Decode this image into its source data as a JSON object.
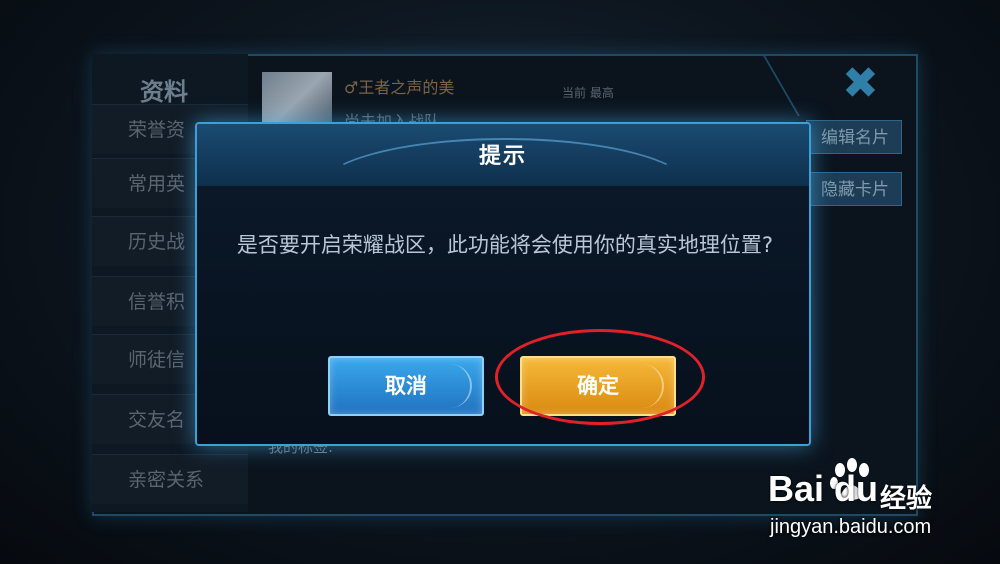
{
  "background": {
    "panel_title": "资料",
    "sidebar_items": [
      "荣誉资",
      "常用英",
      "历史战",
      "信誉积",
      "师徒信",
      "交友名",
      "亲密关系"
    ],
    "player_name": "♂王者之声的美",
    "join_text": "尚未加入战队",
    "rank_labels": "当前  最高",
    "buttons": [
      "编辑名片",
      "隐藏卡片"
    ],
    "close_symbol": "✖",
    "tag_label": "我的标签:"
  },
  "dialog": {
    "title": "提示",
    "message": "是否要开启荣耀战区，此功能将会使用你的真实地理位置?",
    "cancel_label": "取消",
    "confirm_label": "确定"
  },
  "annotation": {
    "color": "#e0212a",
    "target": "confirm-button"
  },
  "watermark": {
    "logo": "Bai du",
    "jingyan": "经验",
    "url": "jingyan.baidu.com"
  }
}
